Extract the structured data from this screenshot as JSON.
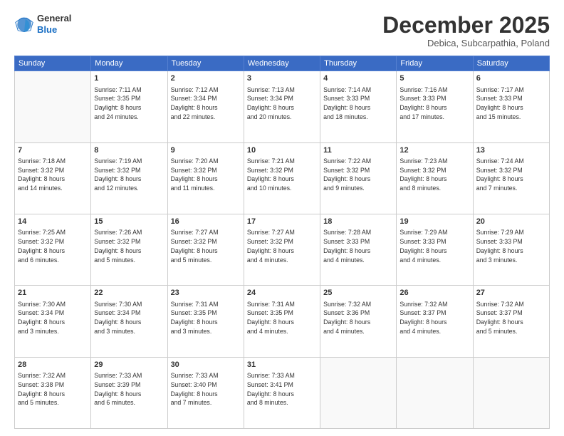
{
  "header": {
    "logo_general": "General",
    "logo_blue": "Blue",
    "month_title": "December 2025",
    "location": "Debica, Subcarpathia, Poland"
  },
  "weekdays": [
    "Sunday",
    "Monday",
    "Tuesday",
    "Wednesday",
    "Thursday",
    "Friday",
    "Saturday"
  ],
  "weeks": [
    [
      {
        "day": "",
        "info": ""
      },
      {
        "day": "1",
        "info": "Sunrise: 7:11 AM\nSunset: 3:35 PM\nDaylight: 8 hours\nand 24 minutes."
      },
      {
        "day": "2",
        "info": "Sunrise: 7:12 AM\nSunset: 3:34 PM\nDaylight: 8 hours\nand 22 minutes."
      },
      {
        "day": "3",
        "info": "Sunrise: 7:13 AM\nSunset: 3:34 PM\nDaylight: 8 hours\nand 20 minutes."
      },
      {
        "day": "4",
        "info": "Sunrise: 7:14 AM\nSunset: 3:33 PM\nDaylight: 8 hours\nand 18 minutes."
      },
      {
        "day": "5",
        "info": "Sunrise: 7:16 AM\nSunset: 3:33 PM\nDaylight: 8 hours\nand 17 minutes."
      },
      {
        "day": "6",
        "info": "Sunrise: 7:17 AM\nSunset: 3:33 PM\nDaylight: 8 hours\nand 15 minutes."
      }
    ],
    [
      {
        "day": "7",
        "info": "Sunrise: 7:18 AM\nSunset: 3:32 PM\nDaylight: 8 hours\nand 14 minutes."
      },
      {
        "day": "8",
        "info": "Sunrise: 7:19 AM\nSunset: 3:32 PM\nDaylight: 8 hours\nand 12 minutes."
      },
      {
        "day": "9",
        "info": "Sunrise: 7:20 AM\nSunset: 3:32 PM\nDaylight: 8 hours\nand 11 minutes."
      },
      {
        "day": "10",
        "info": "Sunrise: 7:21 AM\nSunset: 3:32 PM\nDaylight: 8 hours\nand 10 minutes."
      },
      {
        "day": "11",
        "info": "Sunrise: 7:22 AM\nSunset: 3:32 PM\nDaylight: 8 hours\nand 9 minutes."
      },
      {
        "day": "12",
        "info": "Sunrise: 7:23 AM\nSunset: 3:32 PM\nDaylight: 8 hours\nand 8 minutes."
      },
      {
        "day": "13",
        "info": "Sunrise: 7:24 AM\nSunset: 3:32 PM\nDaylight: 8 hours\nand 7 minutes."
      }
    ],
    [
      {
        "day": "14",
        "info": "Sunrise: 7:25 AM\nSunset: 3:32 PM\nDaylight: 8 hours\nand 6 minutes."
      },
      {
        "day": "15",
        "info": "Sunrise: 7:26 AM\nSunset: 3:32 PM\nDaylight: 8 hours\nand 5 minutes."
      },
      {
        "day": "16",
        "info": "Sunrise: 7:27 AM\nSunset: 3:32 PM\nDaylight: 8 hours\nand 5 minutes."
      },
      {
        "day": "17",
        "info": "Sunrise: 7:27 AM\nSunset: 3:32 PM\nDaylight: 8 hours\nand 4 minutes."
      },
      {
        "day": "18",
        "info": "Sunrise: 7:28 AM\nSunset: 3:33 PM\nDaylight: 8 hours\nand 4 minutes."
      },
      {
        "day": "19",
        "info": "Sunrise: 7:29 AM\nSunset: 3:33 PM\nDaylight: 8 hours\nand 4 minutes."
      },
      {
        "day": "20",
        "info": "Sunrise: 7:29 AM\nSunset: 3:33 PM\nDaylight: 8 hours\nand 3 minutes."
      }
    ],
    [
      {
        "day": "21",
        "info": "Sunrise: 7:30 AM\nSunset: 3:34 PM\nDaylight: 8 hours\nand 3 minutes."
      },
      {
        "day": "22",
        "info": "Sunrise: 7:30 AM\nSunset: 3:34 PM\nDaylight: 8 hours\nand 3 minutes."
      },
      {
        "day": "23",
        "info": "Sunrise: 7:31 AM\nSunset: 3:35 PM\nDaylight: 8 hours\nand 3 minutes."
      },
      {
        "day": "24",
        "info": "Sunrise: 7:31 AM\nSunset: 3:35 PM\nDaylight: 8 hours\nand 4 minutes."
      },
      {
        "day": "25",
        "info": "Sunrise: 7:32 AM\nSunset: 3:36 PM\nDaylight: 8 hours\nand 4 minutes."
      },
      {
        "day": "26",
        "info": "Sunrise: 7:32 AM\nSunset: 3:37 PM\nDaylight: 8 hours\nand 4 minutes."
      },
      {
        "day": "27",
        "info": "Sunrise: 7:32 AM\nSunset: 3:37 PM\nDaylight: 8 hours\nand 5 minutes."
      }
    ],
    [
      {
        "day": "28",
        "info": "Sunrise: 7:32 AM\nSunset: 3:38 PM\nDaylight: 8 hours\nand 5 minutes."
      },
      {
        "day": "29",
        "info": "Sunrise: 7:33 AM\nSunset: 3:39 PM\nDaylight: 8 hours\nand 6 minutes."
      },
      {
        "day": "30",
        "info": "Sunrise: 7:33 AM\nSunset: 3:40 PM\nDaylight: 8 hours\nand 7 minutes."
      },
      {
        "day": "31",
        "info": "Sunrise: 7:33 AM\nSunset: 3:41 PM\nDaylight: 8 hours\nand 8 minutes."
      },
      {
        "day": "",
        "info": ""
      },
      {
        "day": "",
        "info": ""
      },
      {
        "day": "",
        "info": ""
      }
    ]
  ]
}
